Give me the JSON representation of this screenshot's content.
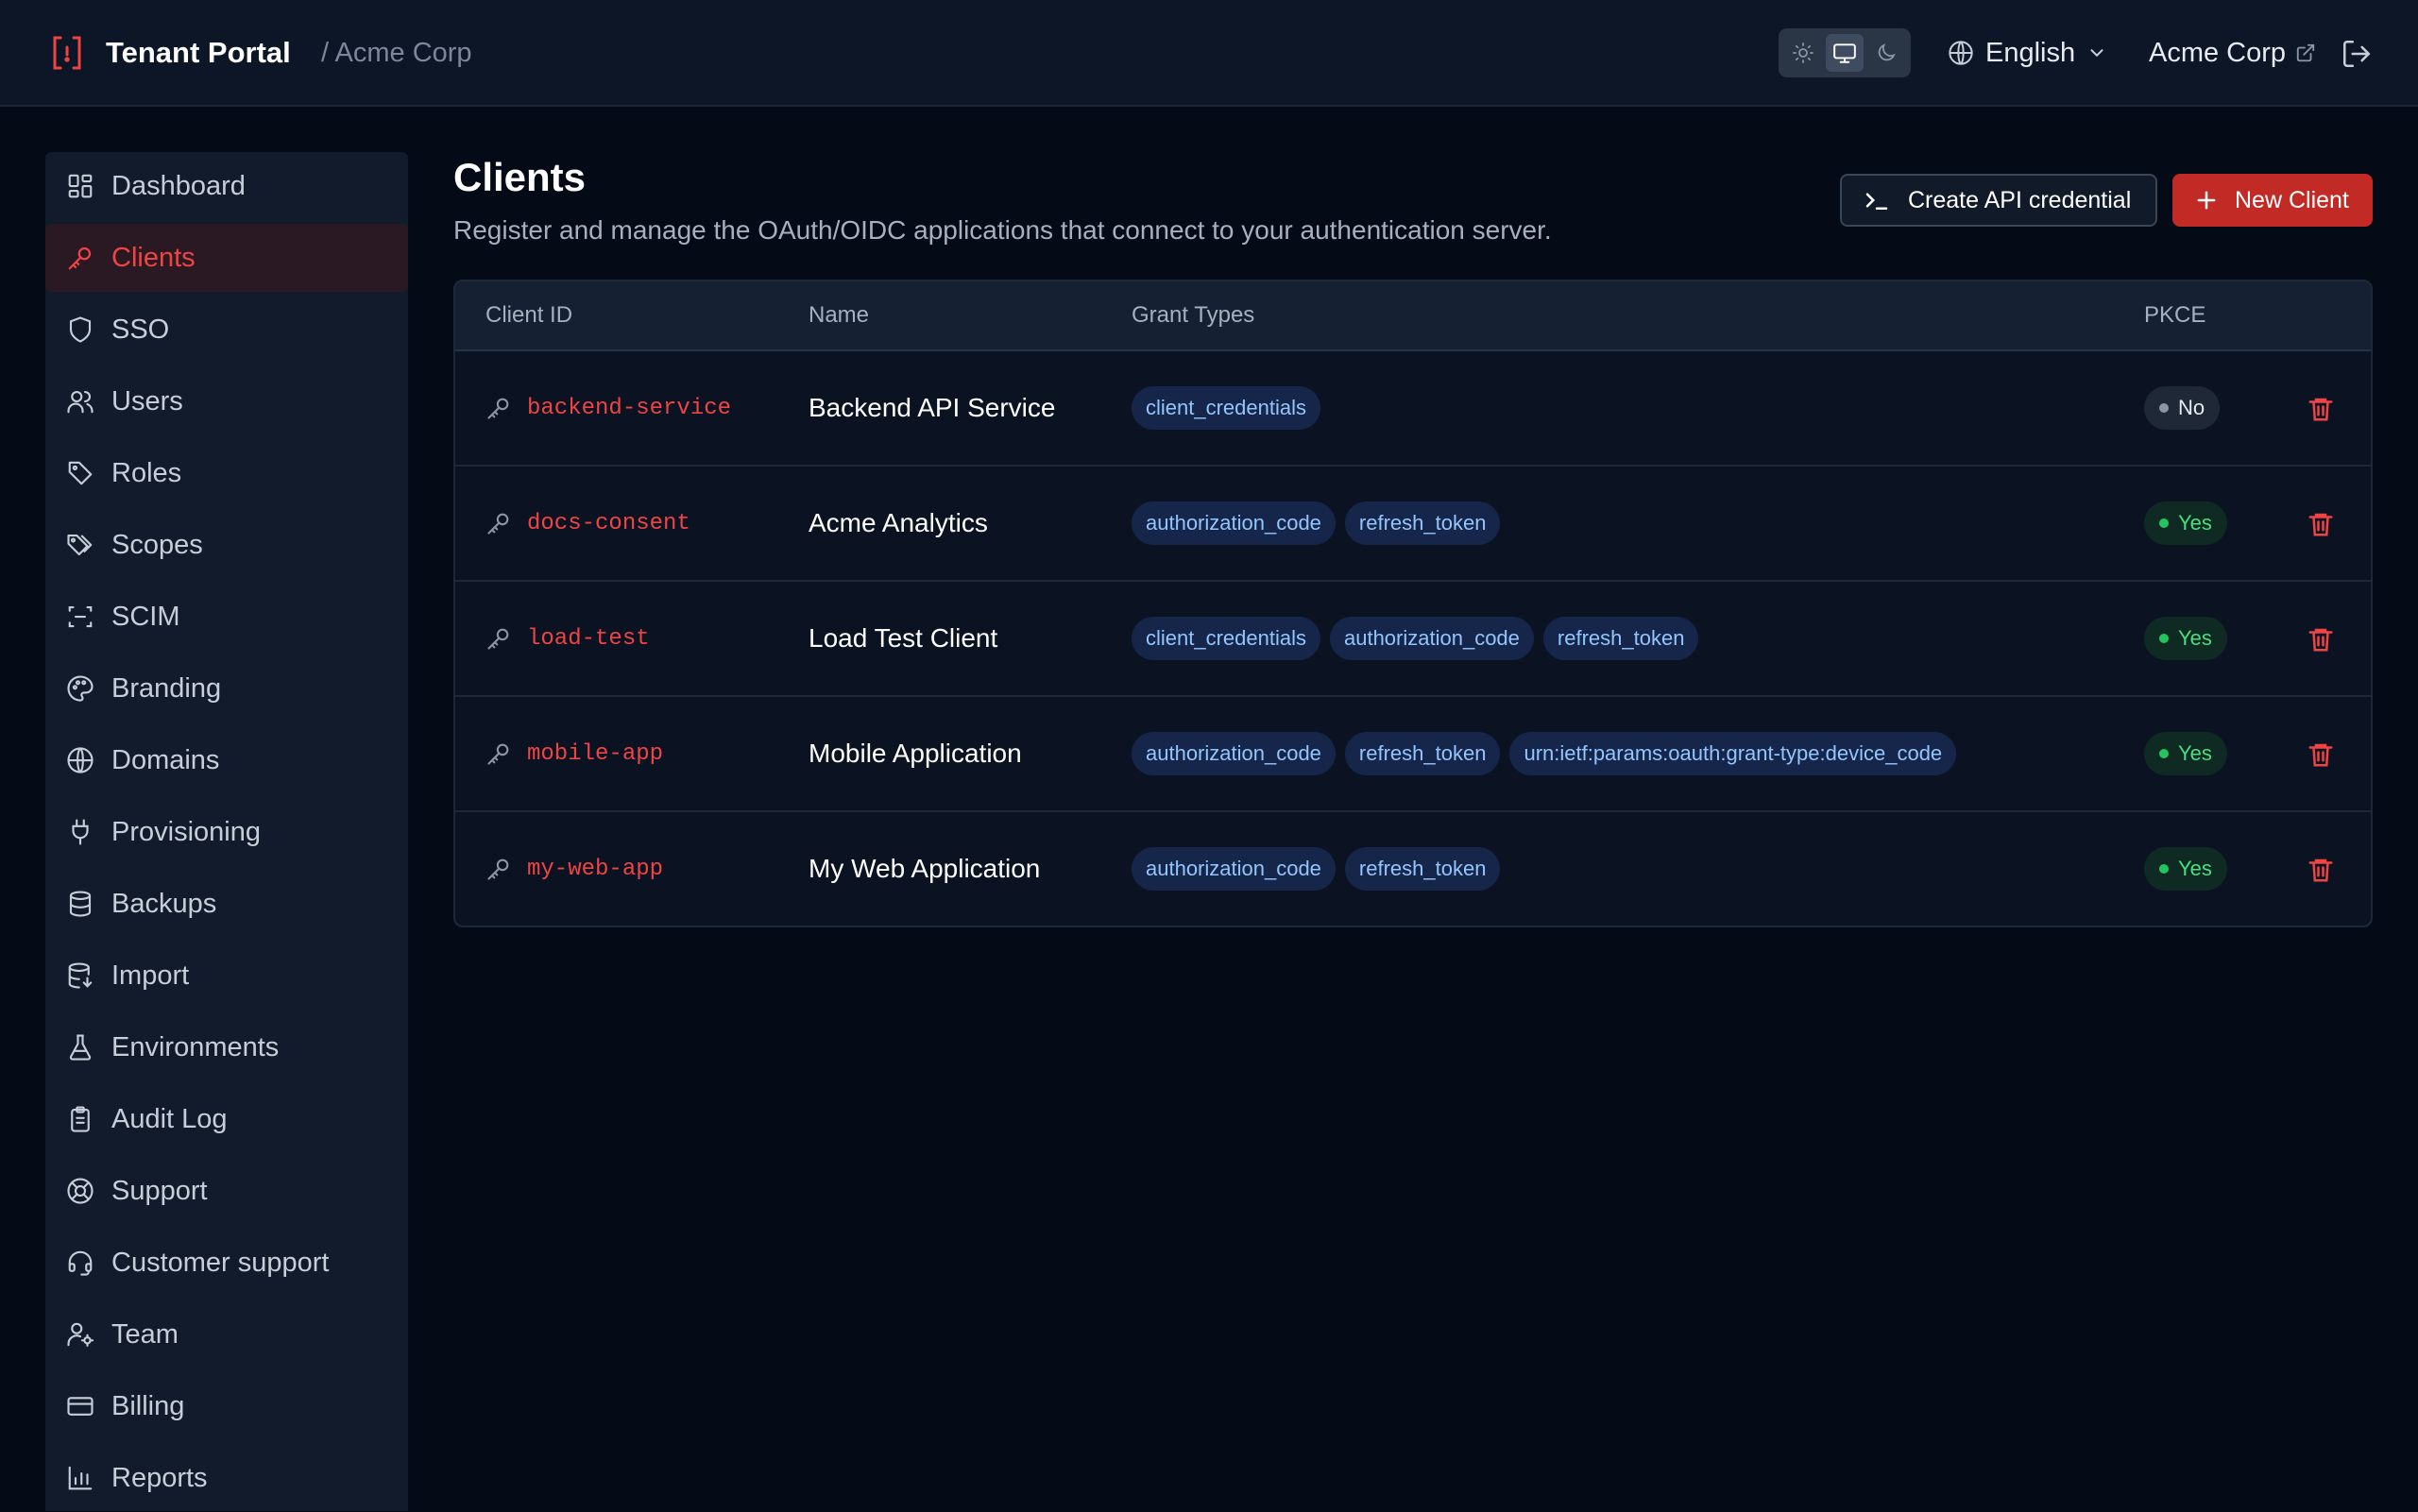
{
  "header": {
    "title": "Tenant Portal",
    "breadcrumb": "/ Acme Corp",
    "theme_modes": [
      "light-icon",
      "monitor-icon",
      "moon-icon"
    ],
    "theme_selected": "monitor-icon",
    "language": "English",
    "tenant_link": "Acme Corp"
  },
  "sidebar": {
    "items": [
      {
        "label": "Dashboard",
        "icon": "dashboard-icon"
      },
      {
        "label": "Clients",
        "icon": "key-icon",
        "active": true
      },
      {
        "label": "SSO",
        "icon": "shield-icon"
      },
      {
        "label": "Users",
        "icon": "users-icon"
      },
      {
        "label": "Roles",
        "icon": "tag-icon"
      },
      {
        "label": "Scopes",
        "icon": "tags-icon"
      },
      {
        "label": "SCIM",
        "icon": "scan-icon"
      },
      {
        "label": "Branding",
        "icon": "palette-icon"
      },
      {
        "label": "Domains",
        "icon": "globe-icon"
      },
      {
        "label": "Provisioning",
        "icon": "plug-icon"
      },
      {
        "label": "Backups",
        "icon": "database-icon"
      },
      {
        "label": "Import",
        "icon": "database-import-icon"
      },
      {
        "label": "Environments",
        "icon": "flask-icon"
      },
      {
        "label": "Audit Log",
        "icon": "clipboard-icon"
      },
      {
        "label": "Support",
        "icon": "lifebuoy-icon"
      },
      {
        "label": "Customer support",
        "icon": "headset-icon"
      },
      {
        "label": "Team",
        "icon": "user-cog-icon"
      },
      {
        "label": "Billing",
        "icon": "credit-card-icon"
      },
      {
        "label": "Reports",
        "icon": "bar-chart-icon"
      }
    ]
  },
  "main": {
    "title": "Clients",
    "subtitle": "Register and manage the OAuth/OIDC applications that connect to your authentication server.",
    "create_credential_label": "Create API credential",
    "new_client_label": "New Client",
    "table": {
      "columns": [
        "Client ID",
        "Name",
        "Grant Types",
        "PKCE"
      ],
      "rows": [
        {
          "client_id": "backend-service",
          "name": "Backend API Service",
          "grants": [
            "client_credentials"
          ],
          "pkce": "No"
        },
        {
          "client_id": "docs-consent",
          "name": "Acme Analytics",
          "grants": [
            "authorization_code",
            "refresh_token"
          ],
          "pkce": "Yes"
        },
        {
          "client_id": "load-test",
          "name": "Load Test Client",
          "grants": [
            "client_credentials",
            "authorization_code",
            "refresh_token"
          ],
          "pkce": "Yes"
        },
        {
          "client_id": "mobile-app",
          "name": "Mobile Application",
          "grants": [
            "authorization_code",
            "refresh_token",
            "urn:ietf:params:oauth:grant-type:device_code"
          ],
          "pkce": "Yes"
        },
        {
          "client_id": "my-web-app",
          "name": "My Web Application",
          "grants": [
            "authorization_code",
            "refresh_token"
          ],
          "pkce": "Yes"
        }
      ]
    }
  },
  "colors": {
    "accent": "#c12a25",
    "accent_text": "#ef4444",
    "background": "#040a16",
    "surface": "#111b2b",
    "grant_badge_bg": "#16264a",
    "grant_badge_text": "#93c5fd",
    "pkce_yes": "#4ade80"
  }
}
